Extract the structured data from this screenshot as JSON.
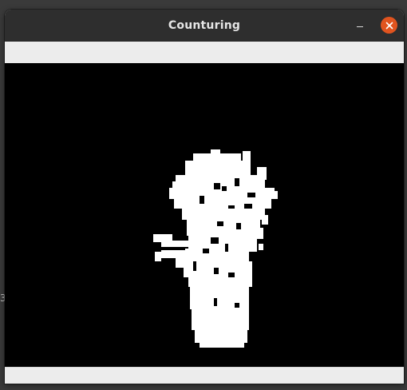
{
  "window": {
    "title": "Counturing"
  },
  "background": {
    "edge_glyph": "3"
  },
  "icons": {
    "minimize": "minimize-icon",
    "close": "close-icon"
  },
  "colors": {
    "titlebar": "#2e2e2e",
    "close_button": "#e1541f",
    "canvas": "#000000",
    "blob": "#ffffff",
    "panel": "#ececec"
  }
}
